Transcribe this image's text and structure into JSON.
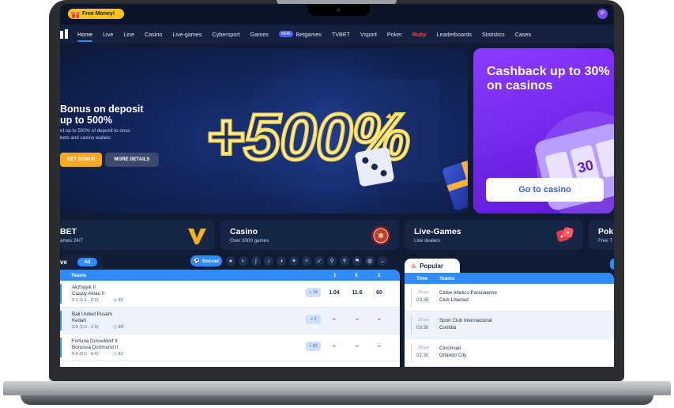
{
  "topbar": {
    "promo_label": "Free Money!",
    "profile_initial": "P"
  },
  "nav": {
    "items": [
      {
        "label": "Home",
        "active": true
      },
      {
        "label": "Live"
      },
      {
        "label": "Line"
      },
      {
        "label": "Casino"
      },
      {
        "label": "Live-games"
      },
      {
        "label": "Cybersport"
      },
      {
        "label": "Games"
      },
      {
        "label": "Betgames",
        "badge": "NEW"
      },
      {
        "label": "TVBET"
      },
      {
        "label": "Vsport"
      },
      {
        "label": "Poker"
      },
      {
        "label": "Ruby",
        "brand": true
      },
      {
        "label": "Leaderboards"
      },
      {
        "label": "Statistics"
      },
      {
        "label": "Cases"
      }
    ]
  },
  "hero": {
    "title": "Bonus on deposit up to 500%",
    "subtitle": "et up to 500% of deposit to onus bets and casino wallets",
    "primary_button": "GET BONUS",
    "secondary_button": "MORE DETAILS",
    "art_text": "+500%"
  },
  "cashback": {
    "title": "Cashback up to 30% on casinos",
    "button": "Go to casino"
  },
  "categories": [
    {
      "title": "BET",
      "subtitle": "ames 24/7"
    },
    {
      "title": "Casino",
      "subtitle": "Over 3000 games"
    },
    {
      "title": "Live-Games",
      "subtitle": "Live dealers"
    },
    {
      "title": "Pok",
      "subtitle": "Free T"
    }
  ],
  "live": {
    "tab_label": "ve",
    "all_chip": "All",
    "soccer_chip": "Soccer",
    "columns": {
      "teams": "Teams",
      "one": "1",
      "x": "X",
      "two": "2"
    },
    "rows": [
      {
        "team1": "Akzhayik II",
        "team2": "Caspiy Aktau II",
        "score": "2:1 (1:1 · 0:0)",
        "time": "92'",
        "more": "+ 18",
        "o1": "1.04",
        "ox": "11.6",
        "o2": "60"
      },
      {
        "team1": "Bali United Pusam",
        "team2": "Kedah",
        "score": "2:0 (1:0 · 1:0)",
        "time": "90'",
        "more": "+ 3",
        "o1": "–",
        "ox": "–",
        "o2": "–"
      },
      {
        "team1": "Fortuna Dusseldorf II",
        "team2": "Borussia Dortmund II",
        "score": "0:4 (0:0 · 0:4)",
        "time": "81'",
        "more": "+ 82",
        "o1": "–",
        "ox": "–",
        "o2": "–"
      }
    ]
  },
  "popular": {
    "tab_label": "Popular",
    "columns": {
      "time": "Time",
      "teams": "Teams"
    },
    "rows": [
      {
        "date": "29 jun",
        "time": "03:30",
        "team1": "Clube Atletico Paranaense",
        "team2": "Club Libertad"
      },
      {
        "date": "29 jun",
        "time": "03:30",
        "team1": "Sport Club Internacional",
        "team2": "Coritiba"
      },
      {
        "date": "29 jun",
        "time": "02:30",
        "team1": "Cincinnati",
        "team2": "Orlando City"
      }
    ]
  },
  "colors": {
    "accent": "#2e8cff",
    "bonus": "#f7a824",
    "cashback": "#7a2cf0",
    "background": "#0f1a33"
  }
}
